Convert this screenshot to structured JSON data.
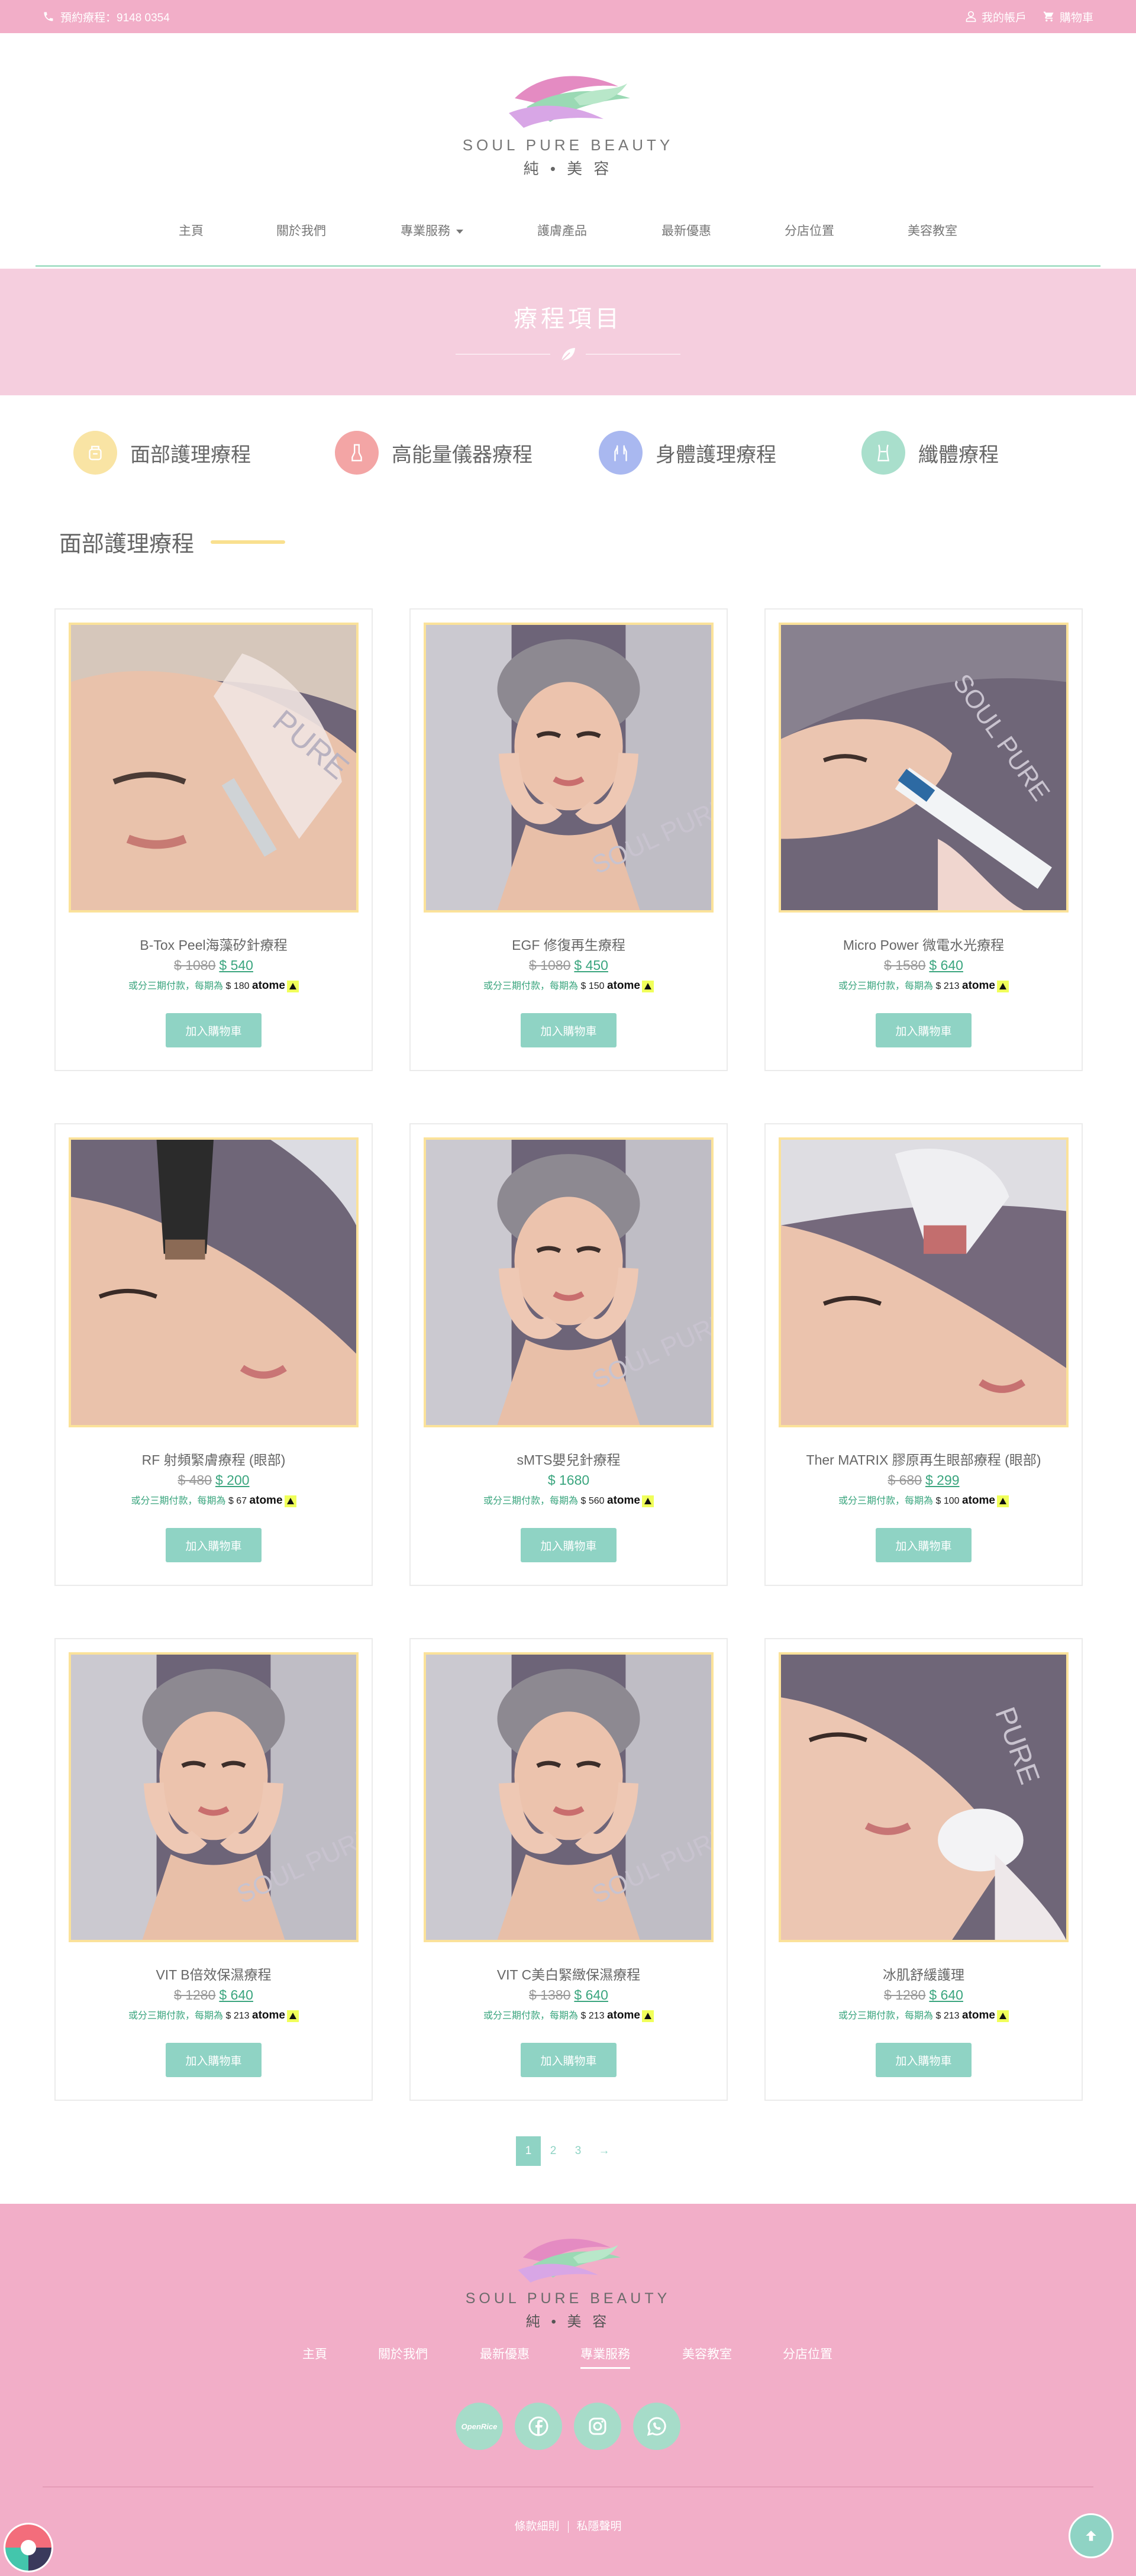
{
  "topbar": {
    "phone": "預約療程：9148 0354",
    "account": "我的帳戶",
    "cart": "購物車"
  },
  "brand": {
    "name": "SOUL PURE BEAUTY",
    "name_cn": "純 • 美 容"
  },
  "nav": {
    "items": [
      "主頁",
      "關於我們",
      "專業服務",
      "護膚產品",
      "最新優惠",
      "分店位置",
      "美容教室"
    ]
  },
  "banner": {
    "title": "療程項目"
  },
  "categories": [
    {
      "label": "面部護理療程",
      "icon": "face-cream-icon",
      "color": "#f9e4a4"
    },
    {
      "label": "高能量儀器療程",
      "icon": "device-icon",
      "color": "#f3a5a5"
    },
    {
      "label": "身體護理療程",
      "icon": "body-hands-icon",
      "color": "#a9b8f0"
    },
    {
      "label": "纖體療程",
      "icon": "slimming-icon",
      "color": "#a9dfcc"
    }
  ],
  "section": {
    "title": "面部護理療程"
  },
  "installment": {
    "prefix": "或分三期付款，每期為",
    "brand": "atome"
  },
  "products": [
    {
      "name": "B-Tox Peel海藻矽針療程",
      "old_price": "$ 1080",
      "price": "$ 540",
      "installment": "$ 180",
      "photo": "needle-treatment"
    },
    {
      "name": "EGF 修復再生療程",
      "old_price": "$ 1080",
      "price": "$ 450",
      "installment": "$ 150",
      "photo": "face-massage"
    },
    {
      "name": "Micro Power 微電水光療程",
      "old_price": "$ 1580",
      "price": "$ 640",
      "installment": "$ 213",
      "photo": "micropower-device"
    },
    {
      "name": "RF 射頻緊膚療程 (眼部)",
      "old_price": "$ 480",
      "price": "$ 200",
      "installment": "$ 67",
      "photo": "rf-device"
    },
    {
      "name": "sMTS嬰兒針療程",
      "old_price": "",
      "price": "$ 1680",
      "installment": "$ 560",
      "photo": "face-massage"
    },
    {
      "name": "Ther MATRIX 膠原再生眼部療程 (眼部)",
      "old_price": "$ 680",
      "price": "$ 299",
      "installment": "$ 100",
      "photo": "eye-device"
    },
    {
      "name": "VIT B倍效保濕療程",
      "old_price": "$ 1280",
      "price": "$ 640",
      "installment": "$ 213",
      "photo": "face-massage"
    },
    {
      "name": "VIT C美白緊緻保濕療程",
      "old_price": "$ 1380",
      "price": "$ 640",
      "installment": "$ 213",
      "photo": "face-massage"
    },
    {
      "name": "冰肌舒緩護理",
      "old_price": "$ 1280",
      "price": "$ 640",
      "installment": "$ 213",
      "photo": "cooling-device"
    }
  ],
  "add_to_cart": "加入購物車",
  "pagination": {
    "pages": [
      "1",
      "2",
      "3"
    ],
    "next": "→",
    "current": "1"
  },
  "footer": {
    "nav": [
      "主頁",
      "關於我們",
      "最新優惠",
      "專業服務",
      "美容教室",
      "分店位置"
    ],
    "active": "專業服務",
    "social": [
      "openrice-icon",
      "facebook-icon",
      "instagram-icon",
      "whatsapp-icon"
    ],
    "openrice_label": "OpenRice",
    "links": [
      "條款細則",
      "私隱聲明"
    ]
  },
  "colors": {
    "pink": "#f2aec8",
    "banner_pink": "#f5cede",
    "mint": "#8fd3c4",
    "price_green": "#3aa57e",
    "gold_frame": "#fbe29a"
  }
}
